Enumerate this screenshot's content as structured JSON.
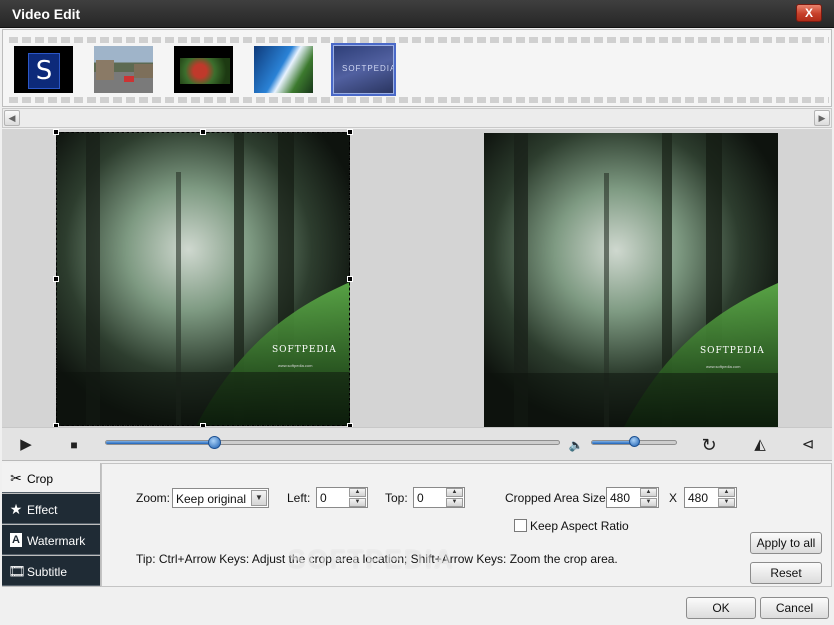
{
  "window": {
    "title": "Video Edit",
    "close_label": "X"
  },
  "filmstrip": {
    "thumbnails": [
      {
        "label": "S",
        "kind": "logo"
      },
      {
        "kind": "street"
      },
      {
        "kind": "flowers"
      },
      {
        "kind": "light"
      },
      {
        "kind": "softpedia",
        "label": "SOFTPEDIA",
        "selected": true
      }
    ]
  },
  "scrollbar": {
    "left_arrow": "◀",
    "right_arrow": "▶"
  },
  "preview": {
    "left_logo": "SOFTPEDIA",
    "left_url": "www.softpedia.com",
    "right_logo": "SOFTPEDIA",
    "right_url": "www.softpedia.com"
  },
  "playback": {
    "play_icon": "▶",
    "stop_icon": "■",
    "progress_fraction": 0.24,
    "volume_fraction": 0.5,
    "volume_icon": "🔈",
    "rotate_icon": "↻",
    "flip_h_icon": "◭",
    "flip_v_icon": "⊲"
  },
  "tabs": [
    {
      "label": "Crop",
      "icon": "scissors-icon",
      "glyph": "✂",
      "active": true
    },
    {
      "label": "Effect",
      "icon": "star-icon",
      "glyph": "★",
      "active": false
    },
    {
      "label": "Watermark",
      "icon": "watermark-icon",
      "glyph": "A",
      "active": false
    },
    {
      "label": "Subtitle",
      "icon": "film-icon",
      "glyph": "🎞",
      "active": false
    }
  ],
  "crop": {
    "zoom_label": "Zoom:",
    "zoom_value": "Keep original",
    "left_label": "Left:",
    "left_value": "0",
    "top_label": "Top:",
    "top_value": "0",
    "cropped_label": "Cropped Area Size:",
    "width_value": "480",
    "x_label": "X",
    "height_value": "480",
    "keep_aspect_label": "Keep Aspect Ratio",
    "keep_aspect_checked": false,
    "tip": "Tip: Ctrl+Arrow Keys: Adjust the crop area location; Shift+Arrow Keys: Zoom the crop area.",
    "apply_all_label": "Apply to all",
    "reset_label": "Reset"
  },
  "footer": {
    "ok_label": "OK",
    "cancel_label": "Cancel"
  },
  "overlay_watermark": "SOFTPEDIA"
}
